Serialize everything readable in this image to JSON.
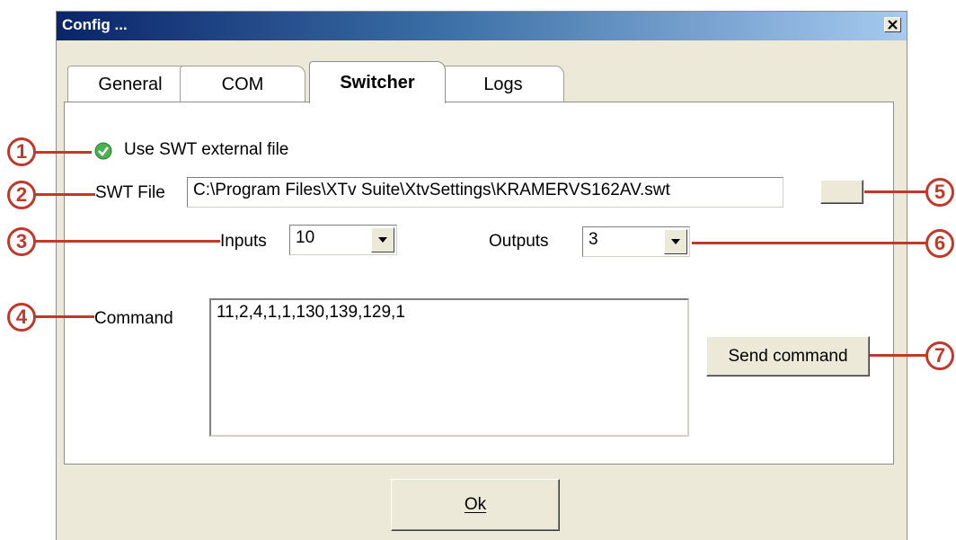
{
  "window": {
    "title": "Config ...",
    "close_glyph": "×"
  },
  "tabs": [
    {
      "label": "General"
    },
    {
      "label": "COM"
    },
    {
      "label": "Switcher",
      "active": true
    },
    {
      "label": "Logs"
    }
  ],
  "switcher": {
    "use_swt_label": "Use SWT external file",
    "use_swt_checked": true,
    "swt_file_label": "SWT File",
    "swt_file_value": "C:\\Program Files\\XTv Suite\\XtvSettings\\KRAMERVS162AV.swt",
    "browse_label": "",
    "inputs_label": "Inputs",
    "inputs_value": "10",
    "outputs_label": "Outputs",
    "outputs_value": "3",
    "command_label": "Command",
    "command_value": "11,2,4,1,1,130,139,129,1",
    "send_label": "Send command"
  },
  "footer": {
    "ok_label": "Ok"
  },
  "callouts": [
    "1",
    "2",
    "3",
    "4",
    "5",
    "6",
    "7"
  ],
  "colors": {
    "callout": "#c0392b",
    "title_gradient_start": "#0a246a",
    "check_green": "#4caf50"
  }
}
